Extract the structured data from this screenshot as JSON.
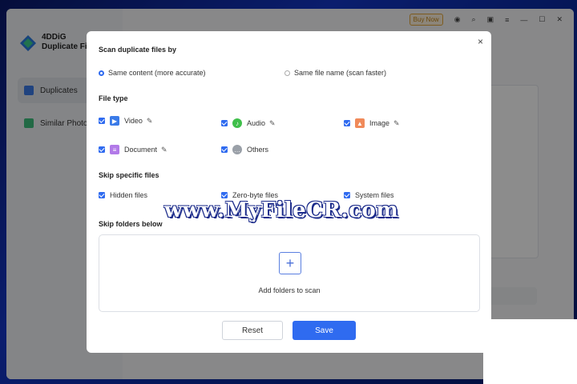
{
  "app": {
    "brand_line1": "4DDiG",
    "brand_line2": "Duplicate File",
    "buy_now": "Buy Now",
    "nav": [
      {
        "label": "Duplicates",
        "active": true
      },
      {
        "label": "Similar Photos",
        "active": false
      }
    ]
  },
  "modal": {
    "close": "×",
    "scan_by_title": "Scan duplicate files by",
    "scan_options": [
      {
        "label": "Same content (more accurate)",
        "selected": true
      },
      {
        "label": "Same file name (scan faster)",
        "selected": false
      }
    ],
    "file_type_title": "File type",
    "file_types": [
      {
        "label": "Video",
        "checked": true,
        "icon": "video-icon",
        "editable": true
      },
      {
        "label": "Audio",
        "checked": true,
        "icon": "audio-icon",
        "editable": true
      },
      {
        "label": "Image",
        "checked": true,
        "icon": "image-icon",
        "editable": true
      },
      {
        "label": "Document",
        "checked": true,
        "icon": "document-icon",
        "editable": true
      },
      {
        "label": "Others",
        "checked": true,
        "icon": "others-icon",
        "editable": false
      }
    ],
    "skip_title": "Skip specific files",
    "skip_options": [
      {
        "label": "Hidden files",
        "checked": true
      },
      {
        "label": "Zero-byte files",
        "checked": true
      },
      {
        "label": "System files",
        "checked": true
      }
    ],
    "skip_folders_title": "Skip folders below",
    "add_folders": "Add folders to scan",
    "reset": "Reset",
    "save": "Save"
  },
  "watermark": "www.MyFileCR.com",
  "colors": {
    "accent": "#2f6bf0",
    "buy_now": "#e4a73b"
  }
}
